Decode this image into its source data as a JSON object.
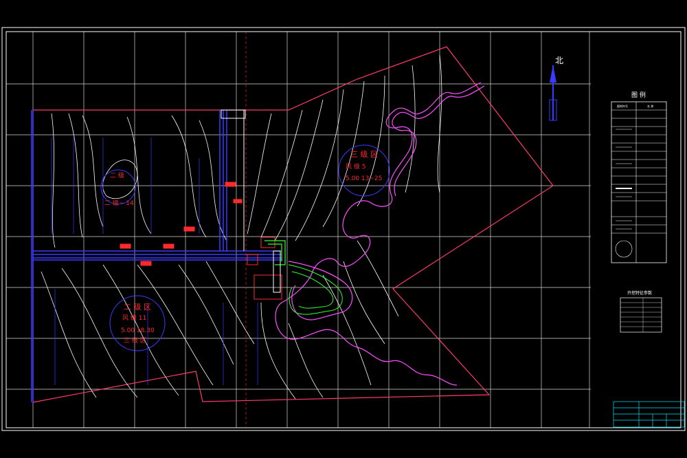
{
  "north_label": "北",
  "zones": {
    "zone3": {
      "name": "三 级 区",
      "line1": "风 级  5",
      "line2": "5.00  13~25"
    },
    "zone2a": {
      "name": "二 级",
      "line1": "二 级~ 14"
    },
    "zone2b": {
      "name": "二 级 区",
      "line1": "风 级  11",
      "line2": "5.00   18.30",
      "line3": "三 级 区"
    }
  },
  "legend": {
    "title": "图 例",
    "col1": "图例符号",
    "col2": "名 称"
  },
  "params": {
    "title": "开挖特征参数"
  },
  "colors": {
    "grid": "#ffffff",
    "border": "#ff3b6b",
    "contour": "#ffffff",
    "water": "#ff4fff",
    "road": "#3b3bff",
    "green": "#33ff33",
    "red": "#ff2a2a",
    "cyan": "#00e5ff"
  }
}
